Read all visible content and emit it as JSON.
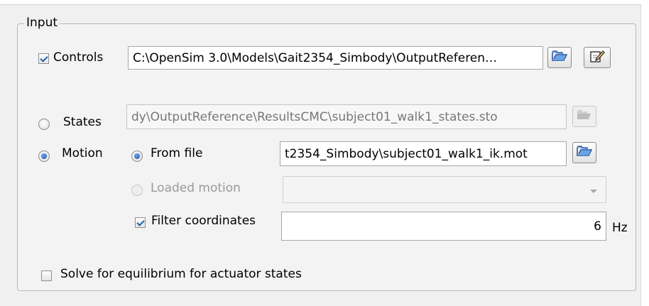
{
  "group": {
    "title": "Input"
  },
  "controls": {
    "checkbox_checked": true,
    "label": "Controls",
    "path": "C:\\OpenSim 3.0\\Models\\Gait2354_Simbody\\OutputReferen…"
  },
  "states": {
    "label": "States",
    "path": "dy\\OutputReference\\ResultsCMC\\subject01_walk1_states.sto"
  },
  "motion": {
    "label": "Motion",
    "from_file": {
      "label": "From file",
      "path": "t2354_Simbody\\subject01_walk1_ik.mot"
    },
    "loaded_motion": {
      "label": "Loaded motion",
      "value": ""
    },
    "filter": {
      "label": "Filter coordinates",
      "value": "6",
      "unit": "Hz"
    }
  },
  "equilibrium": {
    "label": "Solve for equilibrium for actuator states"
  },
  "icons": {
    "open": "folder-open-icon",
    "edit": "edit-icon"
  },
  "colors": {
    "accent": "#1f5fb4",
    "folder": "#3a7bd5"
  }
}
